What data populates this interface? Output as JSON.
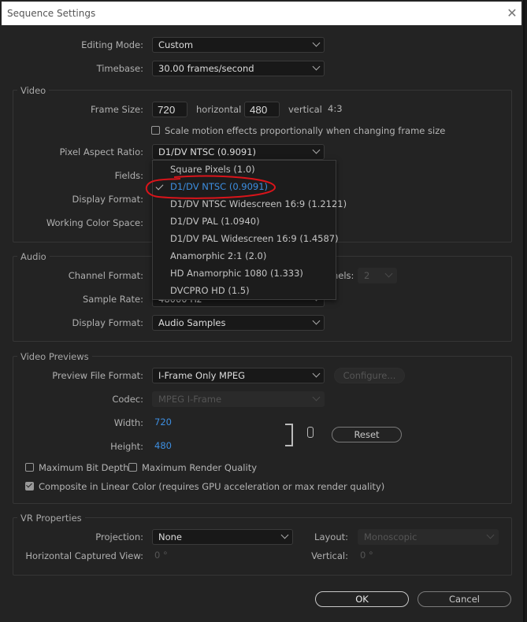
{
  "window": {
    "title": "Sequence Settings",
    "close_icon": "close-icon"
  },
  "general": {
    "editing_mode": {
      "label": "Editing Mode:",
      "value": "Custom"
    },
    "timebase": {
      "label": "Timebase:",
      "value": "30.00  frames/second"
    }
  },
  "video": {
    "group_label": "Video",
    "frame_size": {
      "label": "Frame Size:",
      "horizontal": "720",
      "horizontal_label": "horizontal",
      "vertical": "480",
      "vertical_label": "vertical",
      "aspect": "4:3"
    },
    "scale_motion": {
      "label": "Scale motion effects proportionally when changing frame size",
      "checked": false
    },
    "pixel_aspect_ratio": {
      "label": "Pixel Aspect Ratio:",
      "value": "D1/DV NTSC (0.9091)"
    },
    "fields": {
      "label": "Fields:"
    },
    "display_format": {
      "label": "Display Format:"
    },
    "working_color_space": {
      "label": "Working Color Space:"
    }
  },
  "par_menu": {
    "items": [
      {
        "label": "Square Pixels (1.0)",
        "selected": false
      },
      {
        "label": "D1/DV NTSC (0.9091)",
        "selected": true
      },
      {
        "label": "D1/DV NTSC Widescreen 16:9 (1.2121)",
        "selected": false
      },
      {
        "label": "D1/DV PAL (1.0940)",
        "selected": false
      },
      {
        "label": "D1/DV PAL Widescreen 16:9 (1.4587)",
        "selected": false
      },
      {
        "label": "Anamorphic 2:1 (2.0)",
        "selected": false
      },
      {
        "label": "HD Anamorphic 1080 (1.333)",
        "selected": false
      },
      {
        "label": "DVCPRO HD (1.5)",
        "selected": false
      }
    ],
    "annotation_color": "#d9141a"
  },
  "audio": {
    "group_label": "Audio",
    "channel_format": {
      "label": "Channel Format:"
    },
    "channels": {
      "label_partial": "nels:",
      "value": "2"
    },
    "sample_rate": {
      "label": "Sample Rate:",
      "value": "48000 Hz"
    },
    "display_format": {
      "label": "Display Format:",
      "value": "Audio Samples"
    }
  },
  "video_previews": {
    "group_label": "Video Previews",
    "preview_file_format": {
      "label": "Preview File Format:",
      "value": "I-Frame Only MPEG"
    },
    "configure_button": "Configure...",
    "codec": {
      "label": "Codec:",
      "value": "MPEG I-Frame"
    },
    "width": {
      "label": "Width:",
      "value": "720"
    },
    "height": {
      "label": "Height:",
      "value": "480"
    },
    "reset_button": "Reset",
    "max_bit_depth": {
      "label": "Maximum Bit Depth",
      "checked": false
    },
    "max_render_quality": {
      "label": "Maximum Render Quality",
      "checked": false
    },
    "composite_linear": {
      "label": "Composite in Linear Color (requires GPU acceleration or max render quality)",
      "checked": true
    }
  },
  "vr": {
    "group_label": "VR Properties",
    "projection": {
      "label": "Projection:",
      "value": "None"
    },
    "layout": {
      "label": "Layout:",
      "value": "Monoscopic"
    },
    "horizontal_view": {
      "label": "Horizontal Captured View:",
      "value": "0 °"
    },
    "vertical": {
      "label": "Vertical:",
      "value": "0 °"
    }
  },
  "footer": {
    "ok": "OK",
    "cancel": "Cancel"
  }
}
